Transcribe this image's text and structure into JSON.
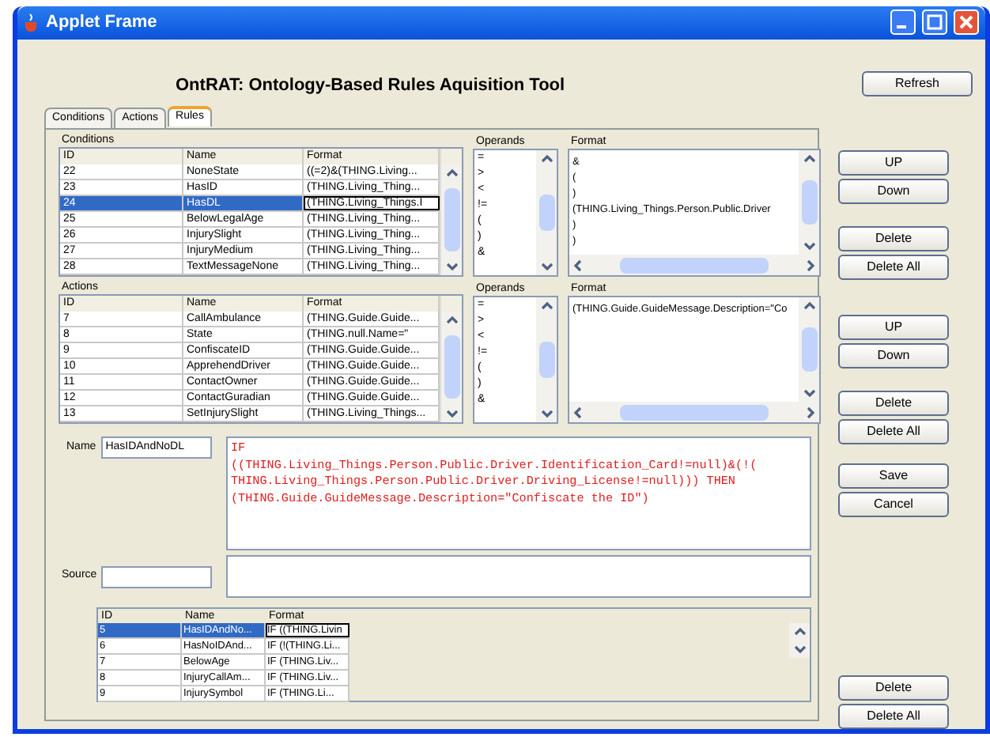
{
  "window": {
    "title": "Applet Frame"
  },
  "heading": "OntRAT: Ontology-Based Rules Aquisition Tool",
  "refresh_button": "Refresh",
  "tabs": [
    {
      "label": "Conditions",
      "selected": false
    },
    {
      "label": "Actions",
      "selected": false
    },
    {
      "label": "Rules",
      "selected": true
    }
  ],
  "conditions": {
    "label": "Conditions",
    "columns": [
      "ID",
      "Name",
      "Format"
    ],
    "rows": [
      {
        "cells": [
          "22",
          "NoneState",
          "((=2)&(THING.Living..."
        ],
        "selected": false
      },
      {
        "cells": [
          "23",
          "HasID",
          "(THING.Living_Thing..."
        ],
        "selected": false
      },
      {
        "cells": [
          "24",
          "HasDL",
          "(THING.Living_Things.I"
        ],
        "selected": true
      },
      {
        "cells": [
          "25",
          "BelowLegalAge",
          "(THING.Living_Thing..."
        ],
        "selected": false
      },
      {
        "cells": [
          "26",
          "InjurySlight",
          "(THING.Living_Thing..."
        ],
        "selected": false
      },
      {
        "cells": [
          "27",
          "InjuryMedium",
          "(THING.Living_Thing..."
        ],
        "selected": false
      },
      {
        "cells": [
          "28",
          "TextMessageNone",
          "(THING.Living_Thing..."
        ],
        "selected": false
      }
    ],
    "operands_label": "Operands",
    "operands": [
      "=",
      ">",
      "<",
      "!=",
      "(",
      ")",
      "&"
    ],
    "format_label": "Format",
    "format_lines": [
      "&",
      "(",
      ")",
      "(THING.Living_Things.Person.Public.Driver",
      ")",
      ")"
    ],
    "buttons": [
      "UP",
      "Down",
      "Delete",
      "Delete All"
    ]
  },
  "actions": {
    "label": "Actions",
    "columns": [
      "ID",
      "Name",
      "Format"
    ],
    "rows": [
      {
        "cells": [
          "7",
          "CallAmbulance",
          "(THING.Guide.Guide..."
        ],
        "selected": false
      },
      {
        "cells": [
          "8",
          "State",
          "(THING.null.Name=\""
        ],
        "selected": false
      },
      {
        "cells": [
          "9",
          "ConfiscateID",
          "(THING.Guide.Guide..."
        ],
        "selected": false
      },
      {
        "cells": [
          "10",
          "ApprehendDriver",
          "(THING.Guide.Guide..."
        ],
        "selected": false
      },
      {
        "cells": [
          "11",
          "ContactOwner",
          "(THING.Guide.Guide..."
        ],
        "selected": false
      },
      {
        "cells": [
          "12",
          "ContactGuradian",
          "(THING.Guide.Guide..."
        ],
        "selected": false
      },
      {
        "cells": [
          "13",
          "SetInjurySlight",
          "(THING.Living_Things..."
        ],
        "selected": false
      }
    ],
    "operands_label": "Operands",
    "operands": [
      "=",
      ">",
      "<",
      "!=",
      "(",
      ")",
      "&"
    ],
    "format_label": "Format",
    "format_lines": [
      "(THING.Guide.GuideMessage.Description=\"Co"
    ],
    "buttons": [
      "UP",
      "Down",
      "Delete",
      "Delete All"
    ]
  },
  "rule": {
    "name_label": "Name",
    "name_value": "HasIDAndNoDL",
    "lines": [
      "IF",
      "((THING.Living_Things.Person.Public.Driver.Identification_Card!=null)&(!(",
      "THING.Living_Things.Person.Public.Driver.Driving_License!=null))) THEN",
      "(THING.Guide.GuideMessage.Description=\"Confiscate the ID\")"
    ],
    "source_label": "Source",
    "buttons": [
      "Save",
      "Cancel"
    ]
  },
  "rules_table": {
    "columns": [
      "ID",
      "Name",
      "Format"
    ],
    "rows": [
      {
        "cells": [
          "5",
          "HasIDAndNo...",
          "IF ((THING.Livin"
        ],
        "selected": true
      },
      {
        "cells": [
          "6",
          "HasNoIDAnd...",
          "IF (!(THING.Li..."
        ],
        "selected": false
      },
      {
        "cells": [
          "7",
          "BelowAge",
          "IF (THING.Liv..."
        ],
        "selected": false
      },
      {
        "cells": [
          "8",
          "InjuryCallAm...",
          "IF (THING.Liv..."
        ],
        "selected": false
      },
      {
        "cells": [
          "9",
          "InjurySymbol",
          "IF (THING.Li..."
        ],
        "selected": false
      }
    ],
    "buttons": [
      "Delete",
      "Delete All"
    ]
  }
}
